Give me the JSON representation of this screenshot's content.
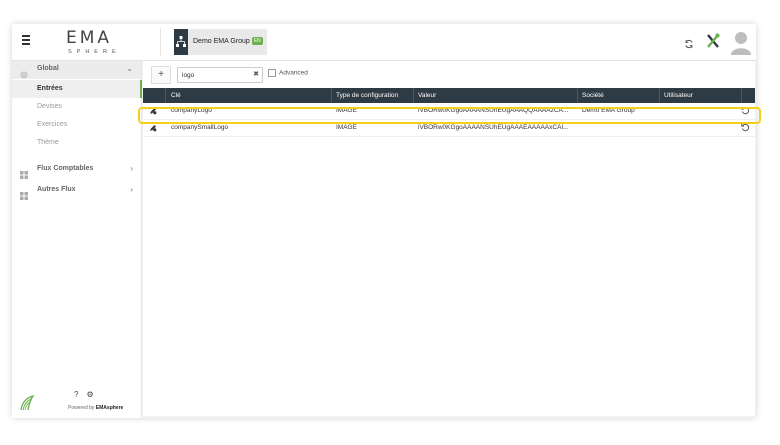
{
  "header": {
    "logo_main": "EMA",
    "logo_sub": "SPHERE",
    "company_name": "Demo EMA Group",
    "company_badge": "EN",
    "menu_icon": "hamburger-icon",
    "refresh_icon": "refresh-icon",
    "tools_icon": "tools-icon",
    "avatar_icon": "user-avatar-icon"
  },
  "sidebar": {
    "groups": [
      {
        "label": "Global",
        "icon": "globe-icon",
        "expanded": true
      },
      {
        "label": "Flux Comptables",
        "icon": "grid-icon"
      },
      {
        "label": "Autres Flux",
        "icon": "grid-icon"
      }
    ],
    "items": [
      {
        "label": "Entrées",
        "active": true
      },
      {
        "label": "Devises"
      },
      {
        "label": "Exercices"
      },
      {
        "label": "Thème"
      }
    ],
    "footer": {
      "powered_prefix": "Powered by",
      "powered_brand": "EMAsphere",
      "help_glyph": "?",
      "settings_glyph": "⚙"
    }
  },
  "toolbar": {
    "add_label": "+",
    "search_value": "logo",
    "clear_glyph": "✖",
    "advanced_label": "Advanced"
  },
  "grid": {
    "columns": [
      "Clé",
      "Type de configuration",
      "Valeur",
      "Société",
      "Utilisateur"
    ],
    "rows": [
      {
        "key": "companyLogo",
        "type": "IMAGE",
        "value": "iVBORw0KGgoAAAANSUhEUgAAAQQAAAAzCA...",
        "company": "Demo EMA Group",
        "user": "",
        "highlighted": true
      },
      {
        "key": "companySmallLogo",
        "type": "IMAGE",
        "value": "iVBORw0KGgoAAAANSUhEUgAAAEAAAAAxCAI...",
        "company": "",
        "user": "",
        "highlighted": false
      }
    ]
  },
  "colors": {
    "header_dark": "#2e3a44",
    "accent_green": "#6ab04c",
    "highlight_yellow": "#f3d11a"
  }
}
